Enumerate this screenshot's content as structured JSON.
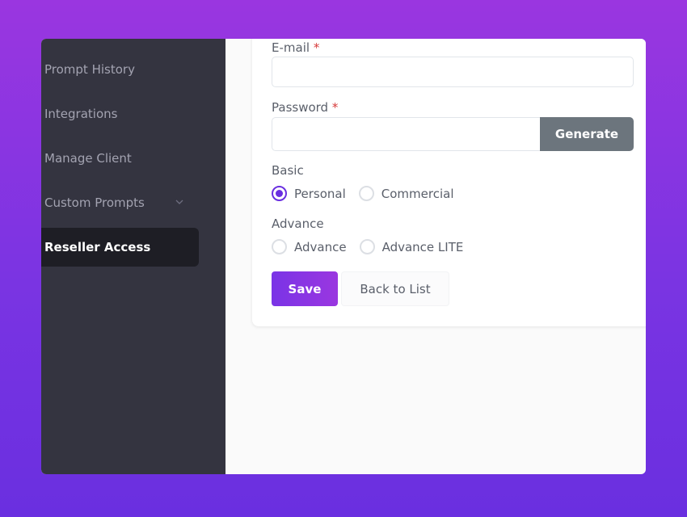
{
  "sidebar": {
    "items": [
      {
        "label": "Prompt History"
      },
      {
        "label": "Integrations"
      },
      {
        "label": "Manage Client"
      },
      {
        "label": "Custom Prompts"
      },
      {
        "label": "Reseller Access"
      }
    ]
  },
  "form": {
    "email": {
      "label": "E-mail",
      "required_mark": "*",
      "value": "",
      "placeholder": ""
    },
    "password": {
      "label": "Password",
      "required_mark": "*",
      "value": "",
      "placeholder": "",
      "generate_label": "Generate"
    },
    "basic": {
      "label": "Basic",
      "options": [
        "Personal",
        "Commercial"
      ],
      "selected": "Personal"
    },
    "advance": {
      "label": "Advance",
      "options": [
        "Advance",
        "Advance LITE"
      ],
      "selected": ""
    },
    "save_label": "Save",
    "back_label": "Back to List"
  },
  "colors": {
    "accent": "#6a2fe0",
    "sidebar_bg": "#343440",
    "active_item_bg": "#1e1e25",
    "generate_bg": "#6c757d",
    "required": "#d63939"
  }
}
